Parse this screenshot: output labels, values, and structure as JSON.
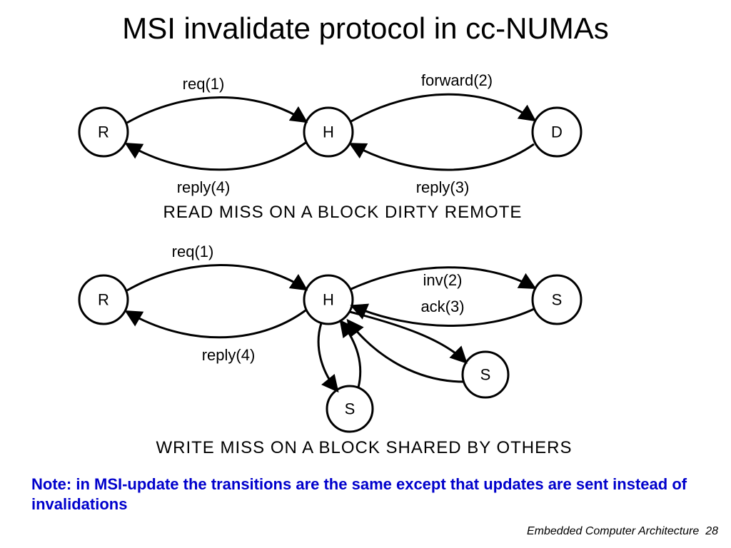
{
  "title": "MSI invalidate protocol in cc-NUMAs",
  "diagram1": {
    "caption": "READ MISS ON A BLOCK DIRTY REMOTE",
    "nodes": {
      "R": "R",
      "H": "H",
      "D": "D"
    },
    "edges": {
      "req": "req(1)",
      "forward": "forward(2)",
      "reply3": "reply(3)",
      "reply4": "reply(4)"
    }
  },
  "diagram2": {
    "caption": "WRITE MISS ON A BLOCK SHARED BY OTHERS",
    "nodes": {
      "R": "R",
      "H": "H",
      "S1": "S",
      "S2": "S",
      "S3": "S"
    },
    "edges": {
      "req": "req(1)",
      "inv": "inv(2)",
      "ack": "ack(3)",
      "reply4": "reply(4)"
    }
  },
  "note": "Note: in MSI-update the transitions are the same except that updates are sent instead of invalidations",
  "footer": {
    "course": "Embedded Computer Architecture",
    "page": "28"
  }
}
